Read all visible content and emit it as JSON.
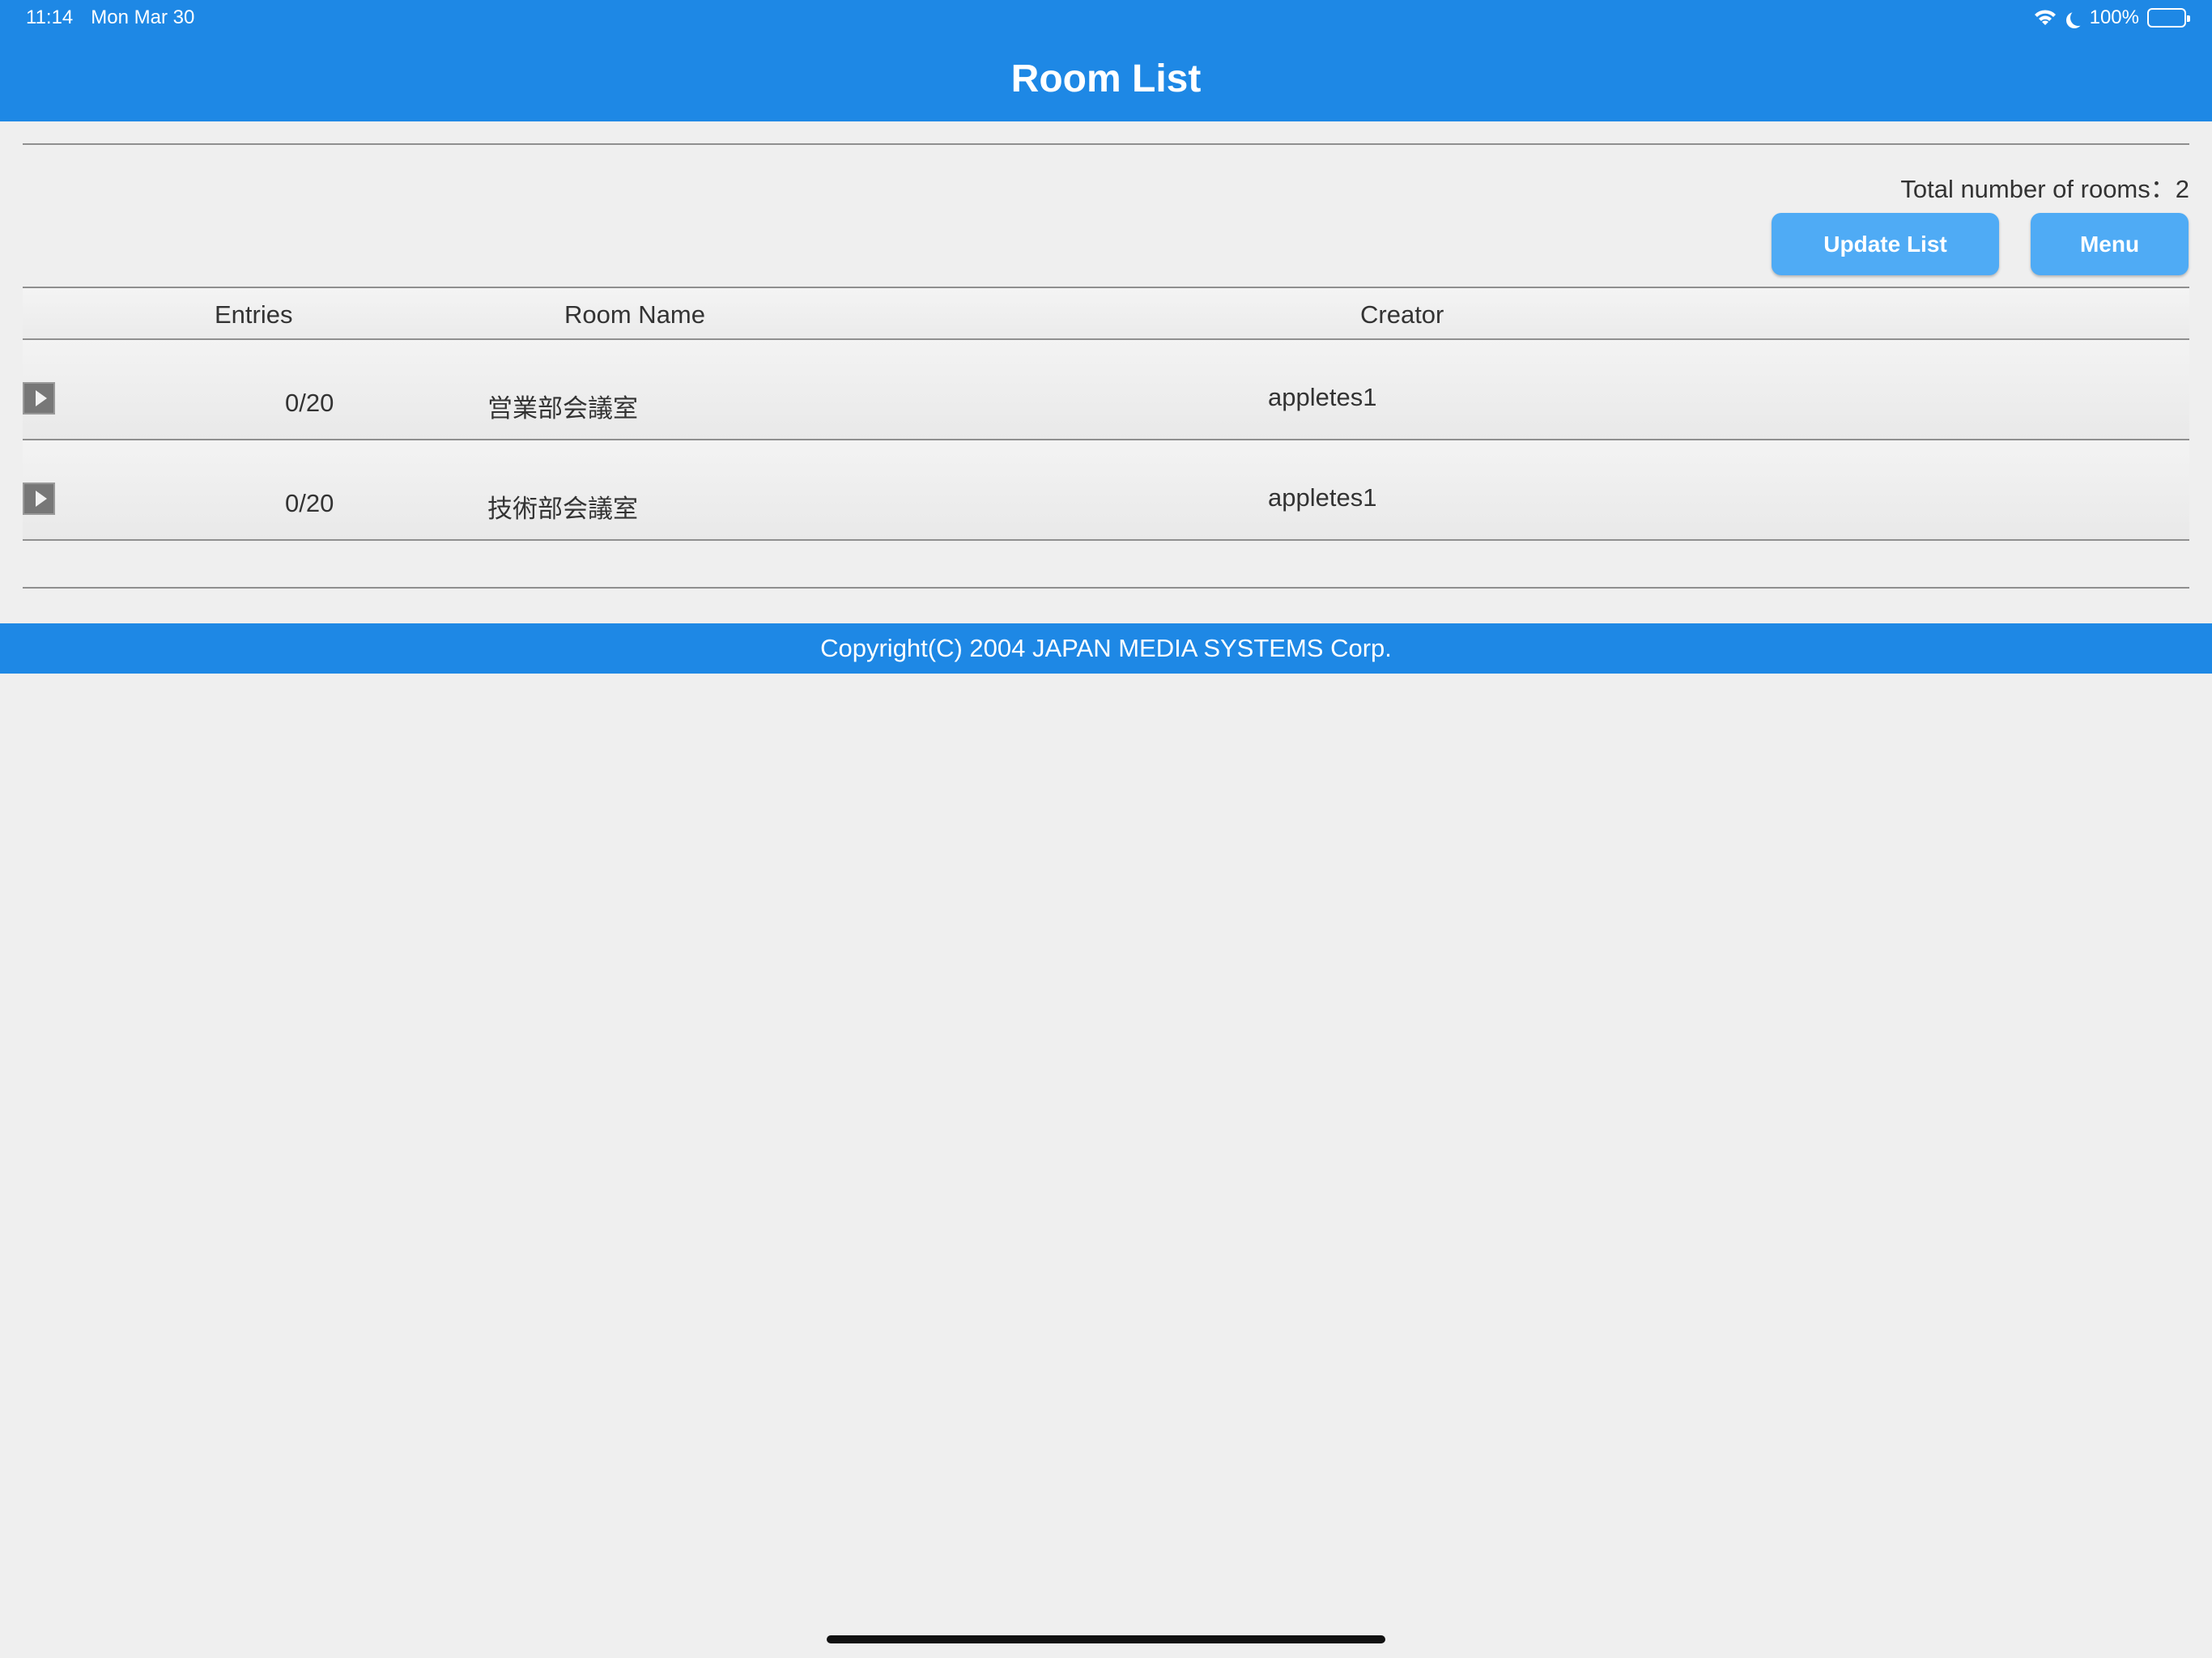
{
  "status_bar": {
    "time": "11:14",
    "date": "Mon Mar 30",
    "battery": "100%",
    "icons": [
      "wifi-icon",
      "moon-icon",
      "battery-icon"
    ]
  },
  "header": {
    "title": "Room List"
  },
  "summary": {
    "total_rooms": "Total number of rooms：2"
  },
  "toolbar": {
    "update_label": "Update List",
    "menu_label": "Menu"
  },
  "table": {
    "columns": [
      "Entries",
      "Room Name",
      "Creator"
    ],
    "rows": [
      {
        "entries": "0/20",
        "room_name": "営業部会議室",
        "creator": "appletes1"
      },
      {
        "entries": "0/20",
        "room_name": "技術部会議室",
        "creator": "appletes1"
      }
    ]
  },
  "footer": {
    "copyright": "Copyright(C) 2004 JAPAN MEDIA SYSTEMS Corp."
  },
  "colors": {
    "header_bg": "#1e88e5",
    "button_bg": "#4fabf5",
    "page_bg": "#efefef"
  }
}
